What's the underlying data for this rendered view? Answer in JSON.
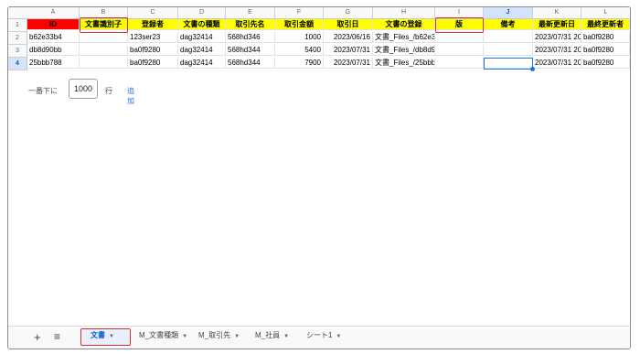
{
  "columns": [
    "A",
    "B",
    "C",
    "D",
    "E",
    "F",
    "G",
    "H",
    "I",
    "J",
    "K",
    "L"
  ],
  "rows": [
    "1",
    "2",
    "3",
    "4"
  ],
  "header_row": [
    "ID",
    "文書識別子",
    "登録者",
    "文書の種類",
    "取引先名",
    "取引金額",
    "取引日",
    "文書の登録",
    "版",
    "備考",
    "最新更新日",
    "最終更新者"
  ],
  "data_rows": [
    [
      "b62e33b4",
      "",
      "123ser23",
      "dag32414",
      "568hd346",
      "1000",
      "2023/06/16",
      "文書_Files_/b62e3",
      "",
      "",
      "2023/07/31 20",
      "ba0f9280"
    ],
    [
      "db8d90bb",
      "",
      "ba0f9280",
      "dag32414",
      "568hd344",
      "5400",
      "2023/07/31",
      "文書_Files_/db8d9",
      "",
      "",
      "2023/07/31 20",
      "ba0f9280"
    ],
    [
      "25bbb788",
      "",
      "ba0f9280",
      "dag32414",
      "568hd344",
      "7900",
      "2023/07/31",
      "文書_Files_/25bbb",
      "",
      "",
      "2023/07/31 20",
      "ba0f9280"
    ]
  ],
  "add_rows": {
    "label": "一番下に",
    "count": "1000",
    "unit": "行",
    "action": "追加"
  },
  "sheet_tabs": [
    "文書",
    "M_文書種類",
    "M_取引先",
    "M_社員",
    "シート1"
  ],
  "active_tab": "文書",
  "icons": {
    "add_sheet": "plus-icon",
    "all_sheets": "menu-icon"
  },
  "colors": {
    "header_fill": "#ffff00",
    "id_fill": "#ff0000",
    "highlight": "#d32f2f",
    "selection": "#1a73e8"
  }
}
